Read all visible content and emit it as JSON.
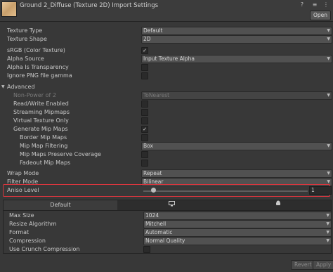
{
  "header": {
    "title": "Ground 2_Diffuse (Texture 2D) Import Settings",
    "open_label": "Open",
    "icons": [
      "help-icon",
      "settings-sliders-icon",
      "more-options-icon"
    ]
  },
  "texture": {
    "texture_type_label": "Texture Type",
    "texture_type_value": "Default",
    "texture_shape_label": "Texture Shape",
    "texture_shape_value": "2D",
    "srgb_label": "sRGB (Color Texture)",
    "srgb_checked": true,
    "alpha_source_label": "Alpha Source",
    "alpha_source_value": "Input Texture Alpha",
    "alpha_transparency_label": "Alpha Is Transparency",
    "alpha_transparency_checked": false,
    "ignore_png_label": "Ignore PNG file gamma",
    "ignore_png_checked": false
  },
  "advanced": {
    "header_label": "Advanced",
    "non_power_label": "Non-Power of 2",
    "non_power_value": "ToNearest",
    "read_write_label": "Read/Write Enabled",
    "streaming_label": "Streaming Mipmaps",
    "virtual_label": "Virtual Texture Only",
    "generate_mip_label": "Generate Mip Maps",
    "generate_mip_checked": true,
    "border_mip_label": "Border Mip Maps",
    "mip_filter_label": "Mip Map Filtering",
    "mip_filter_value": "Box",
    "preserve_cov_label": "Mip Maps Preserve Coverage",
    "fadeout_label": "Fadeout Mip Maps"
  },
  "wrap": {
    "wrap_mode_label": "Wrap Mode",
    "wrap_mode_value": "Repeat",
    "filter_mode_label": "Filter Mode",
    "filter_mode_value": "Bilinear",
    "aniso_label": "Aniso Level",
    "aniso_value": "1"
  },
  "platform": {
    "tabs": [
      "Default",
      "monitor-icon",
      "android-icon"
    ],
    "max_size_label": "Max Size",
    "max_size_value": "1024",
    "resize_label": "Resize Algorithm",
    "resize_value": "Mitchell",
    "format_label": "Format",
    "format_value": "Automatic",
    "compression_label": "Compression",
    "compression_value": "Normal Quality",
    "crunch_label": "Use Crunch Compression",
    "crunch_checked": false
  },
  "footer": {
    "revert_label": "Revert",
    "apply_label": "Apply"
  },
  "colors": {
    "highlight": "#d9363e",
    "background": "#383838"
  }
}
